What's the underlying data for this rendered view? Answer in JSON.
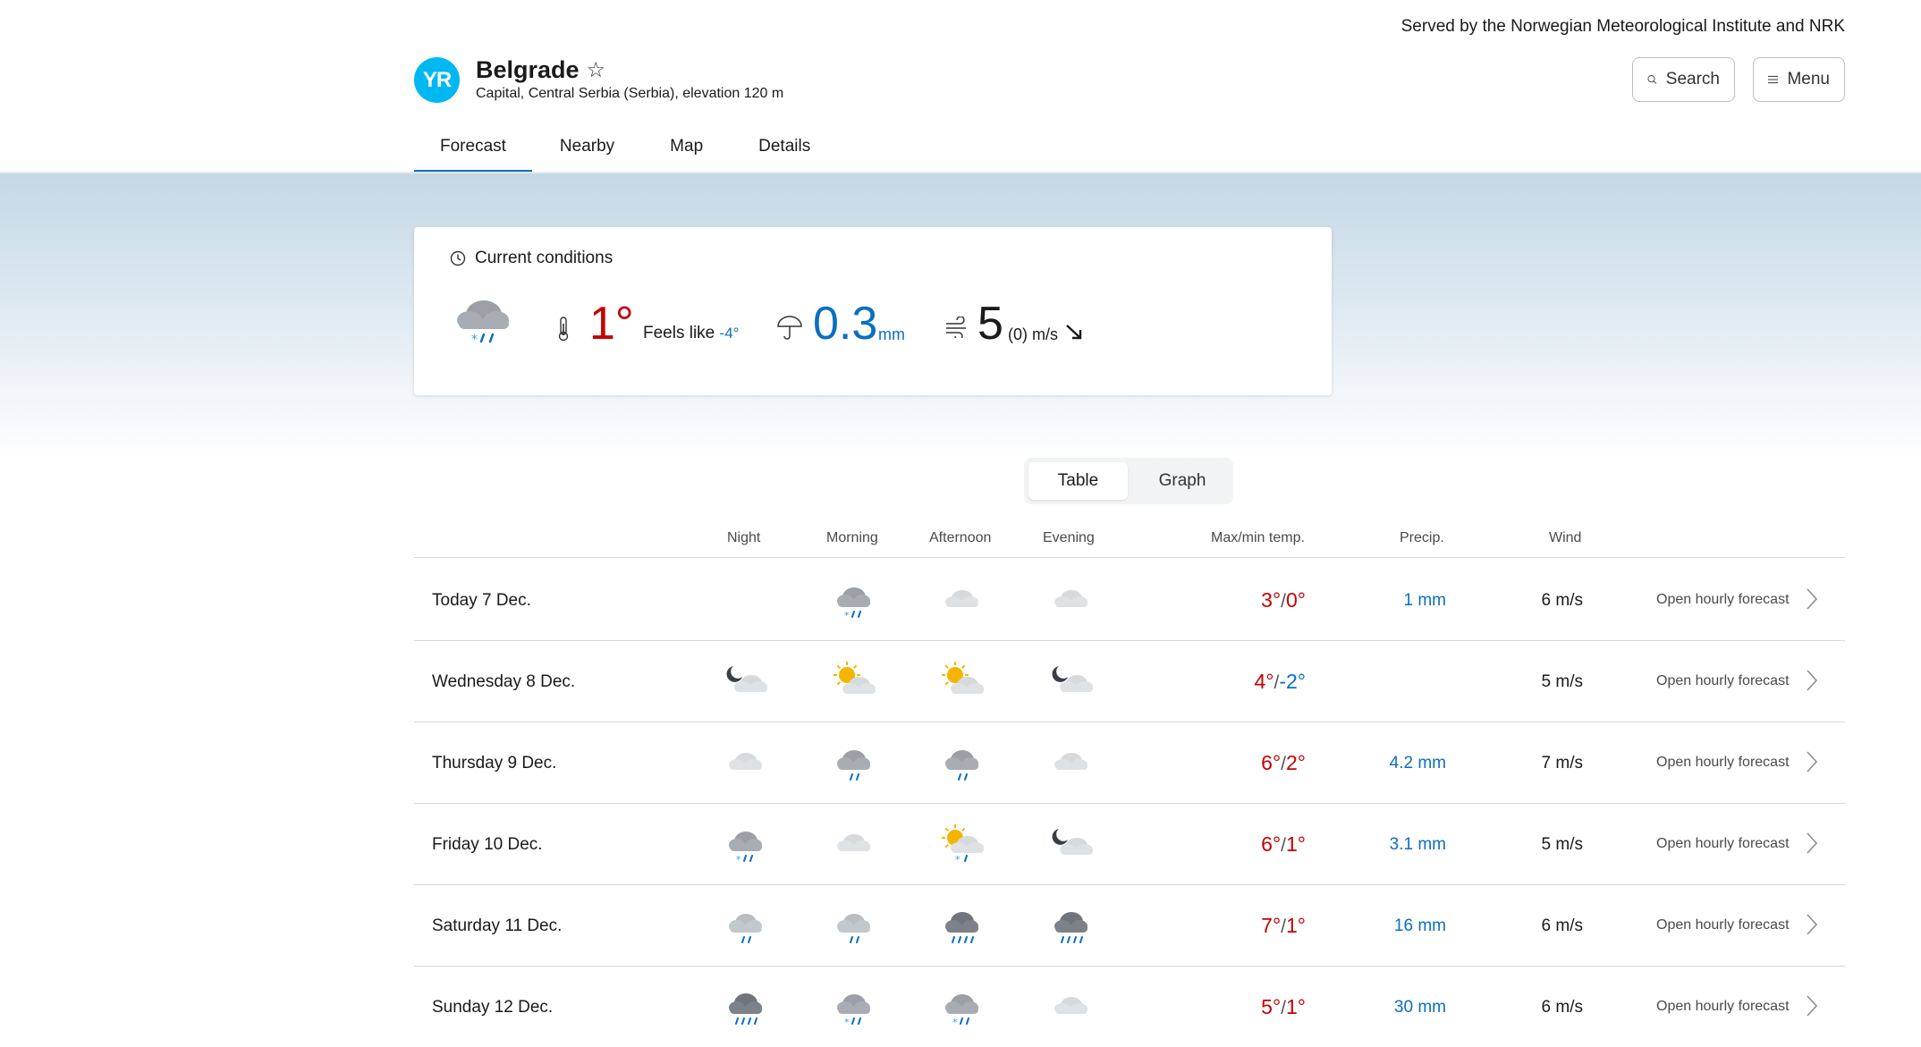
{
  "header": {
    "served_by": "Served by the Norwegian Meteorological Institute and NRK",
    "logo_text": "YR",
    "location_name": "Belgrade",
    "location_sub": "Capital, Central Serbia (Serbia), elevation 120 m",
    "search_label": "Search",
    "menu_label": "Menu",
    "tabs": [
      {
        "label": "Forecast",
        "active": true
      },
      {
        "label": "Nearby",
        "active": false
      },
      {
        "label": "Map",
        "active": false
      },
      {
        "label": "Details",
        "active": false
      }
    ]
  },
  "current": {
    "heading": "Current conditions",
    "icon": "cloud-sleet-icon",
    "temp": "1°",
    "feels_label": "Feels like",
    "feels_value": "-4°",
    "precip_value": "0.3",
    "precip_unit": "mm",
    "wind_value": "5",
    "wind_gust": "(0) m/s"
  },
  "view_toggle": {
    "table": "Table",
    "graph": "Graph",
    "selected": "Table"
  },
  "table": {
    "headers": {
      "night": "Night",
      "morning": "Morning",
      "afternoon": "Afternoon",
      "evening": "Evening",
      "maxmin": "Max/min temp.",
      "precip": "Precip.",
      "wind": "Wind"
    },
    "open_label": "Open hourly forecast",
    "rows": [
      {
        "day": "Today 7 Dec.",
        "icons": [
          "",
          "cloud-sleet-icon",
          "cloud-light-icon",
          "cloud-light-icon"
        ],
        "max": "3°",
        "sep": "/",
        "min": "0°",
        "min_negative": false,
        "precip": "1 mm",
        "wind": "6 m/s"
      },
      {
        "day": "Wednesday 8 Dec.",
        "icons": [
          "moon-cloud-icon",
          "sun-cloud-icon",
          "sun-cloud-icon",
          "moon-cloud-icon"
        ],
        "max": "4°",
        "sep": "/",
        "min": "-2°",
        "min_negative": true,
        "precip": "",
        "wind": "5 m/s"
      },
      {
        "day": "Thursday 9 Dec.",
        "icons": [
          "cloud-light-icon",
          "cloud-rain-icon",
          "cloud-rain-icon",
          "cloud-light-icon"
        ],
        "max": "6°",
        "sep": "/",
        "min": "2°",
        "min_negative": false,
        "precip": "4.2 mm",
        "wind": "7 m/s"
      },
      {
        "day": "Friday 10 Dec.",
        "icons": [
          "cloud-sleet-icon",
          "cloud-light-icon",
          "sun-cloud-sleet-icon",
          "moon-cloud-icon"
        ],
        "max": "6°",
        "sep": "/",
        "min": "1°",
        "min_negative": false,
        "precip": "3.1 mm",
        "wind": "5 m/s"
      },
      {
        "day": "Saturday 11 Dec.",
        "icons": [
          "cloud-light-rain-icon",
          "cloud-light-rain-icon",
          "cloud-heavy-rain-icon",
          "cloud-heavy-rain-icon"
        ],
        "max": "7°",
        "sep": "/",
        "min": "1°",
        "min_negative": false,
        "precip": "16 mm",
        "wind": "6 m/s"
      },
      {
        "day": "Sunday 12 Dec.",
        "icons": [
          "cloud-heavy-rain-icon",
          "cloud-sleet-icon",
          "cloud-sleet-icon",
          "cloud-light-icon"
        ],
        "max": "5°",
        "sep": "/",
        "min": "1°",
        "min_negative": false,
        "precip": "30 mm",
        "wind": "6 m/s"
      }
    ]
  },
  "colors": {
    "accent": "#0c6ec0",
    "warm": "#c60000",
    "logo": "#00b8f1"
  }
}
